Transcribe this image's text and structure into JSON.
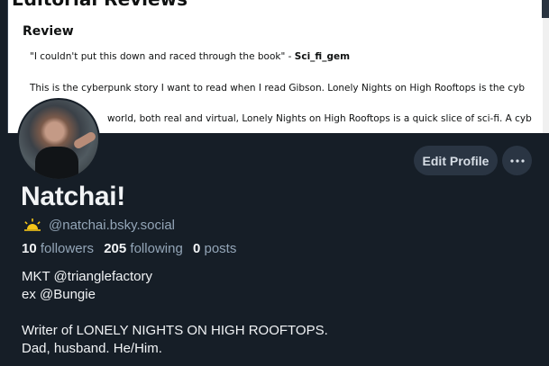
{
  "banner": {
    "section_title": "Editorial Reviews",
    "review_heading": "Review",
    "quote": "\"I couldn't put this down and raced through the book\" -",
    "quote_author": "Sci_fi_gem",
    "line2": "This is the cyberpunk story I want to read when I read Gibson. Lonely Nights on High Rooftops is the cyb",
    "line3": "world, both real and virtual, Lonely Nights on High Rooftops is a quick slice of sci-fi. A cyb"
  },
  "profile": {
    "display_name": "Natchai!",
    "handle": "@natchai.bsky.social",
    "handle_icon": "sun-icon",
    "followers_count": "10",
    "followers_label": "followers",
    "following_count": "205",
    "following_label": "following",
    "posts_count": "0",
    "posts_label": "posts",
    "bio": [
      "MKT @trianglefactory",
      "ex @Bungie",
      "",
      "Writer of LONELY NIGHTS ON HIGH ROOFTOPS.",
      "Dad, husband. He/Him."
    ]
  },
  "actions": {
    "edit_profile_label": "Edit Profile",
    "more_icon": "ellipsis-icon"
  },
  "colors": {
    "background": "#161e27",
    "button_bg": "#2a3543",
    "muted_text": "#93a5b7",
    "primary_text": "#f1f3f5",
    "sun_icon": "#f5c518"
  }
}
